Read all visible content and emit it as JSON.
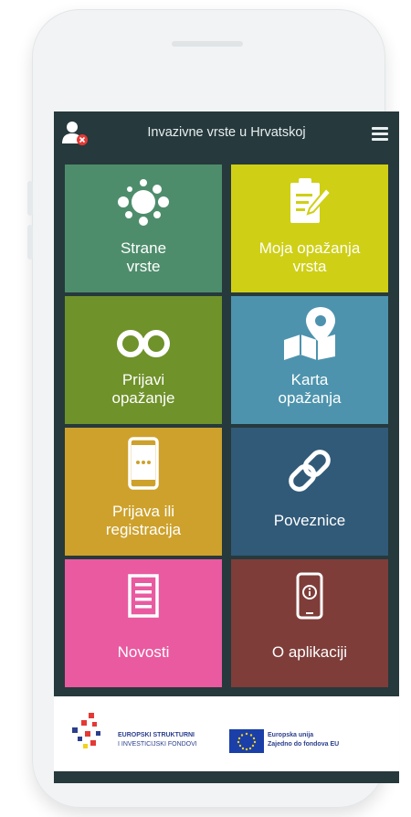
{
  "header": {
    "title": "Invazivne vrste u Hrvatskoj",
    "user_icon": "user-logout-icon",
    "menu_icon": "hamburger-menu-icon"
  },
  "tiles": [
    {
      "label": "Strane vrste",
      "line1": "Strane",
      "line2": "vrste",
      "color": "#4e8d6c",
      "icon": "species-bubbles-icon"
    },
    {
      "label": "Moja opažanja vrsta",
      "line1": "Moja opažanja",
      "line2": "vrsta",
      "color": "#cfcf15",
      "icon": "clipboard-edit-icon"
    },
    {
      "label": "Prijavi opažanje",
      "line1": "Prijavi",
      "line2": "opažanje",
      "color": "#6f922a",
      "icon": "binoculars-icon"
    },
    {
      "label": "Karta opažanja",
      "line1": "Karta",
      "line2": "opažanja",
      "color": "#4d93ad",
      "icon": "map-pin-icon"
    },
    {
      "label": "Prijava ili registracija",
      "line1": "Prijava ili",
      "line2": "registracija",
      "color": "#cda12c",
      "icon": "smartphone-icon"
    },
    {
      "label": "Poveznice",
      "line1": "Poveznice",
      "line2": "",
      "color": "#315a78",
      "icon": "link-icon"
    },
    {
      "label": "Novosti",
      "line1": "Novosti",
      "line2": "",
      "color": "#e95aa0",
      "icon": "news-list-icon"
    },
    {
      "label": "O aplikaciji",
      "line1": "O aplikaciji",
      "line2": "",
      "color": "#7e3d39",
      "icon": "phone-info-icon"
    }
  ],
  "footer": {
    "funds_line1": "EUROPSKI STRUKTURNI",
    "funds_line2": "I INVESTICIJSKI FONDOVI",
    "eu_line1": "Europska unija",
    "eu_line2": "Zajedno do fondova EU",
    "eu_flag_color": "#1a3fa8",
    "eu_star_color": "#f4d020"
  }
}
